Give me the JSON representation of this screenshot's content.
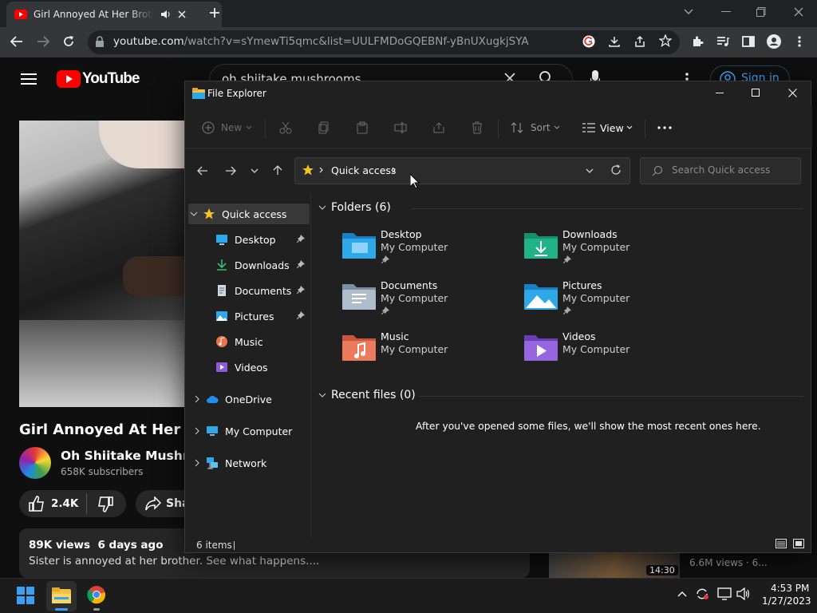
{
  "browser": {
    "tab_title": "Girl Annoyed At Her Brother",
    "url_host": "youtube.com",
    "url_path": "/watch?v=sYmewTi5qmc&list=UULFMDoGQEBNf-yBnUXugkjSYA"
  },
  "youtube": {
    "logo_text": "YouTube",
    "search_value": "oh shiitake mushrooms",
    "signin_label": "Sign in",
    "video_title": "Girl Annoyed At Her Brot",
    "channel_name": "Oh Shiitake Mushroon",
    "subscribers": "658K subscribers",
    "like_count": "2.4K",
    "share_label": "Sha",
    "views_meta": "89K views  6 days ago",
    "description": "Sister is annoyed at her brother. See what happens....",
    "side_duration": "14:30",
    "side_views": "6.6M views  ·  6..."
  },
  "explorer": {
    "title": "File Explorer",
    "cmd": {
      "new_label": "New",
      "sort_label": "Sort",
      "view_label": "View"
    },
    "address": "Quick access",
    "search_placeholder": "Search Quick access",
    "nav": {
      "quick_access": "Quick access",
      "desktop": "Desktop",
      "downloads": "Downloads",
      "documents": "Documents",
      "pictures": "Pictures",
      "music": "Music",
      "videos": "Videos",
      "onedrive": "OneDrive",
      "my_computer": "My Computer",
      "network": "Network"
    },
    "folders_header": "Folders (6)",
    "folders": [
      {
        "name": "Desktop",
        "location": "My Computer"
      },
      {
        "name": "Downloads",
        "location": "My Computer"
      },
      {
        "name": "Documents",
        "location": "My Computer"
      },
      {
        "name": "Pictures",
        "location": "My Computer"
      },
      {
        "name": "Music",
        "location": "My Computer"
      },
      {
        "name": "Videos",
        "location": "My Computer"
      }
    ],
    "recent_header": "Recent files (0)",
    "recent_empty": "After you've opened some files, we'll show the most recent ones here.",
    "status_items": "6 items"
  },
  "taskbar": {
    "time": "4:53 PM",
    "date": "1/27/2023"
  },
  "colors": {
    "yt_red": "#ff0000",
    "accent_blue": "#3ea6ff",
    "folder_blue": "#2ea8e8",
    "star_yellow": "#f6c125"
  }
}
